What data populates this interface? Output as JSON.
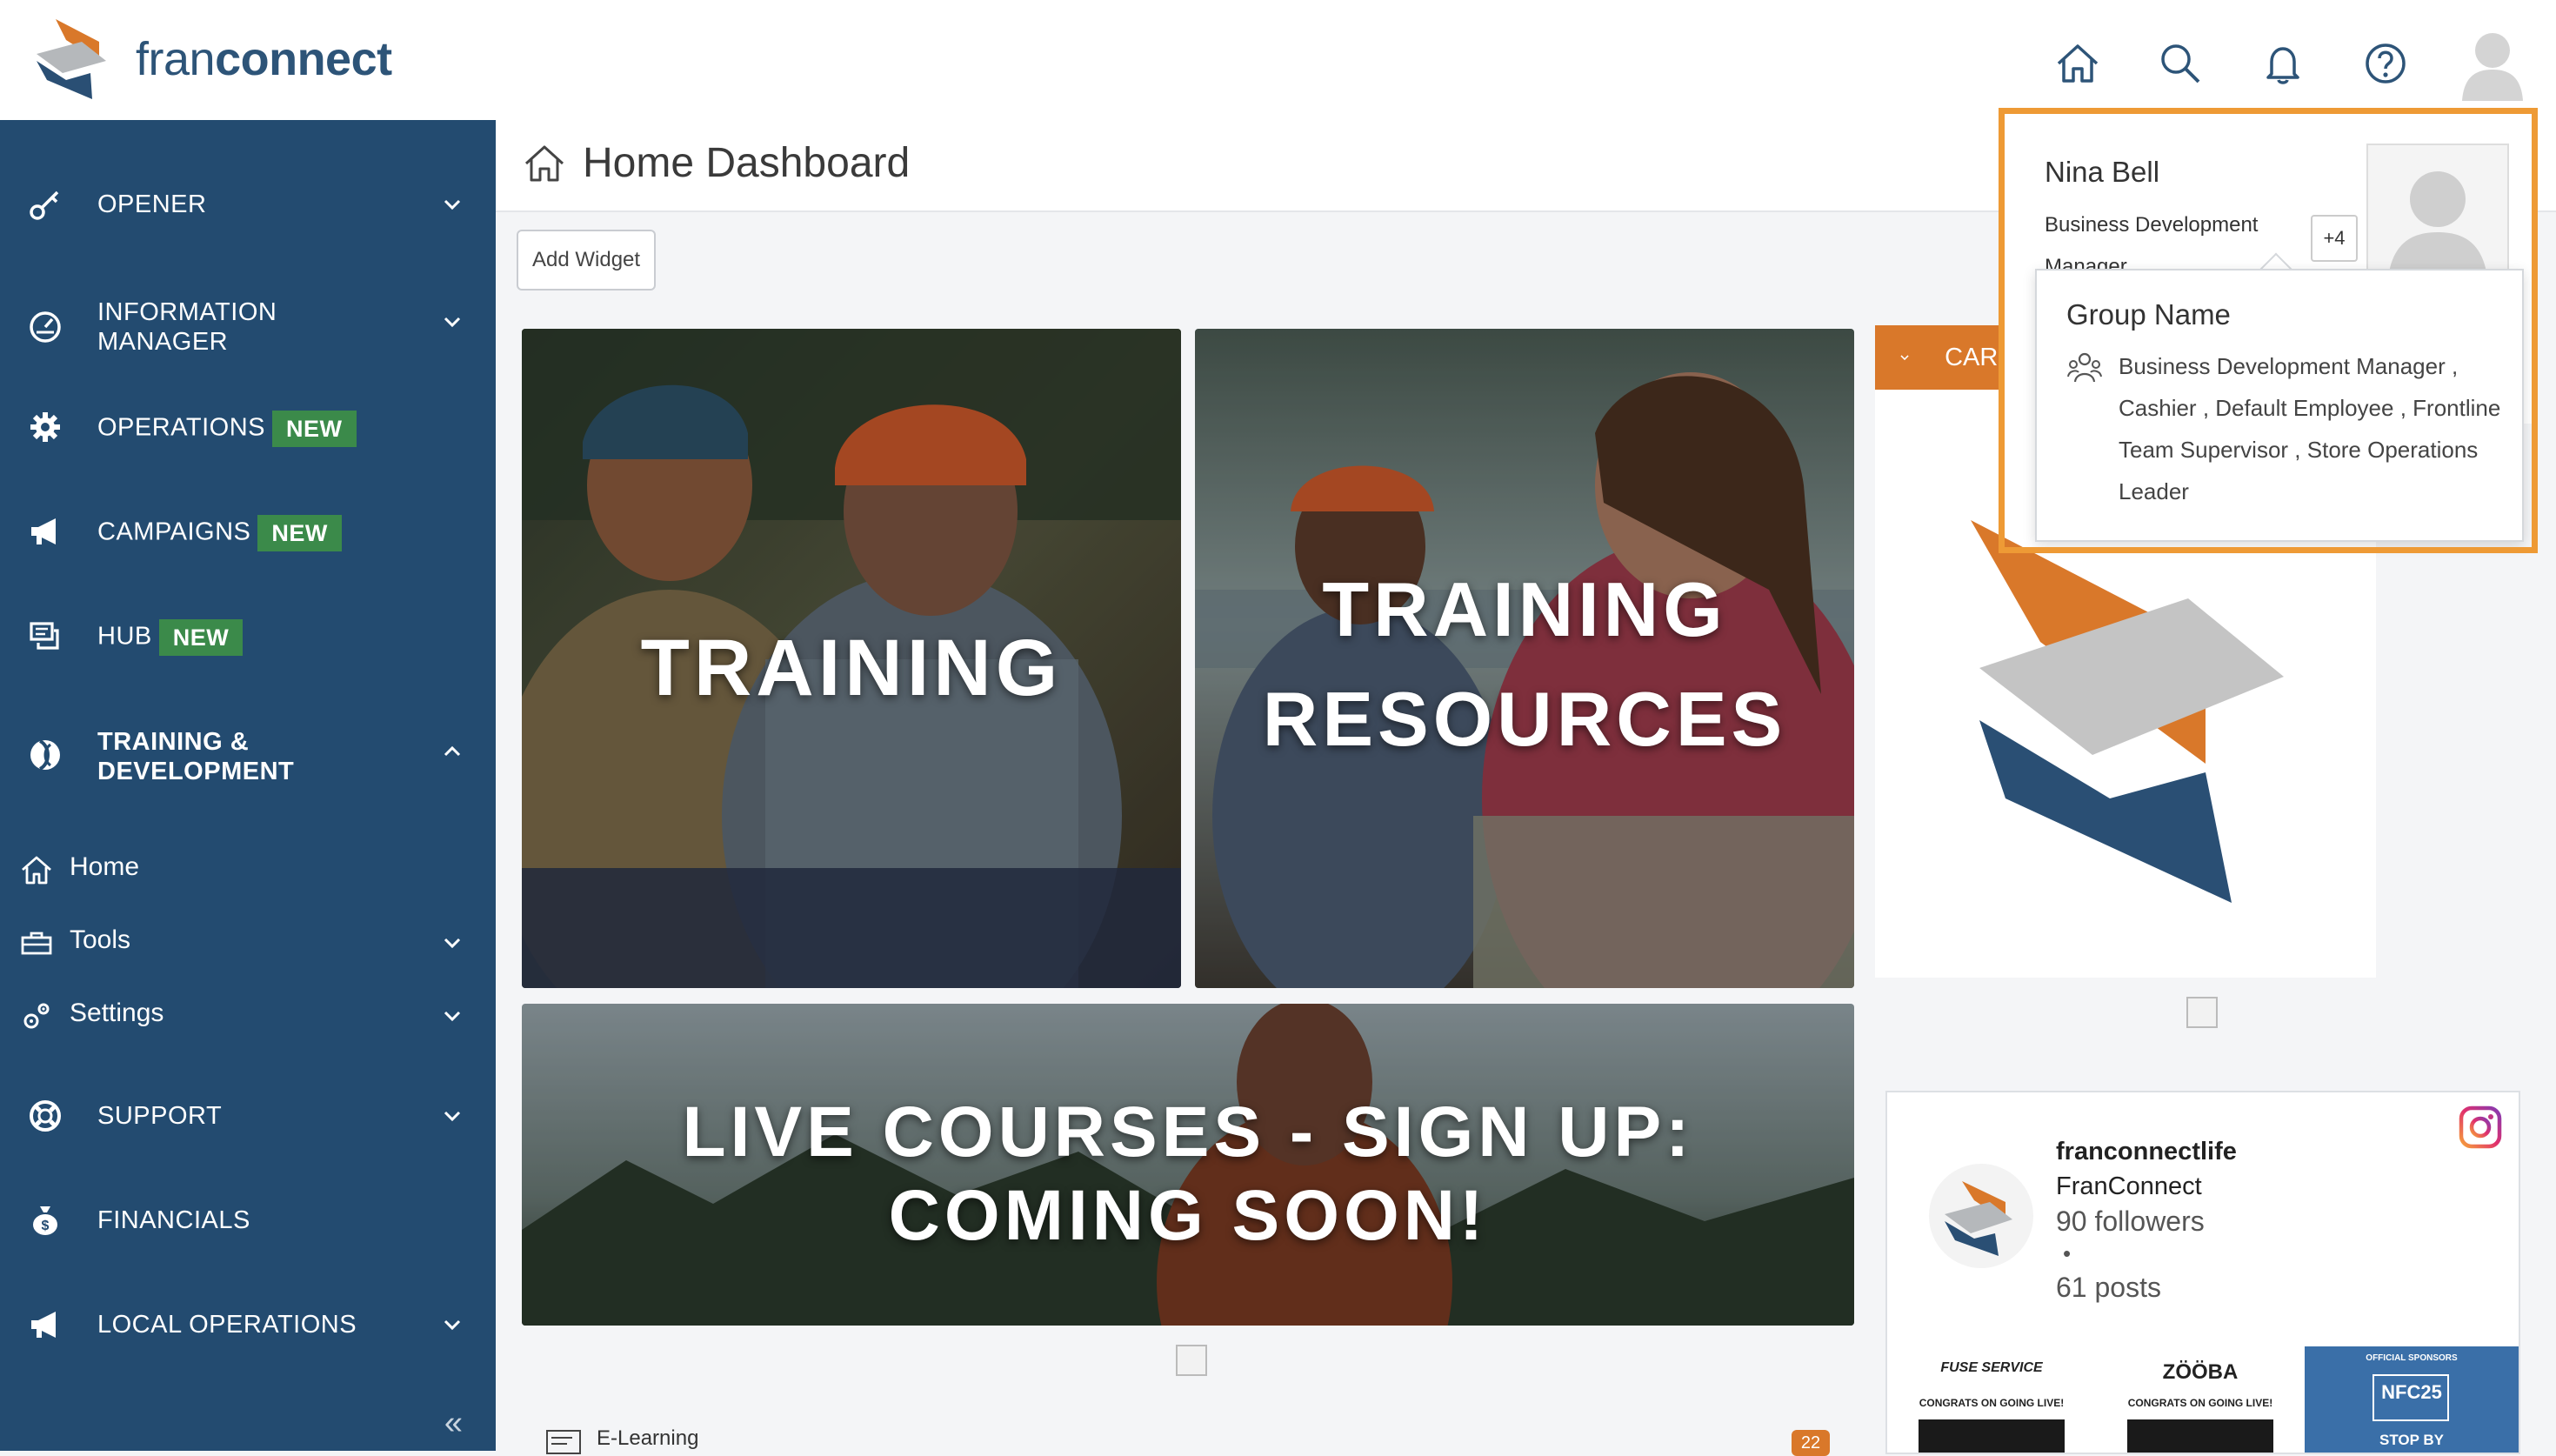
{
  "brand": {
    "name_part1": "fran",
    "name_part2": "connect",
    "accent": "#d9782a",
    "navy": "#234b70"
  },
  "header": {
    "icons": [
      "home-icon",
      "search-icon",
      "bell-icon",
      "help-icon",
      "user-avatar"
    ]
  },
  "sidebar": {
    "items": [
      {
        "label": "OPENER",
        "icon": "key-icon",
        "chevron": "down"
      },
      {
        "label": "INFORMATION",
        "label2": "MANAGER",
        "icon": "gauge-icon",
        "chevron": "down"
      },
      {
        "label": "OPERATIONS",
        "badge": "NEW",
        "icon": "gear-icon"
      },
      {
        "label": "CAMPAIGNS",
        "badge": "NEW",
        "icon": "megaphone-icon"
      },
      {
        "label": "HUB",
        "badge": "NEW",
        "icon": "chat-icon"
      },
      {
        "label": "TRAINING &",
        "label2": "DEVELOPMENT",
        "icon": "training-icon",
        "chevron": "up"
      },
      {
        "label": "SUPPORT",
        "icon": "lifebuoy-icon",
        "chevron": "down"
      },
      {
        "label": "FINANCIALS",
        "icon": "money-bag-icon"
      },
      {
        "label": "LOCAL OPERATIONS",
        "icon": "megaphone-icon",
        "chevron": "down"
      }
    ],
    "subitems": [
      {
        "label": "Home",
        "icon": "home-icon"
      },
      {
        "label": "Tools",
        "icon": "tools-icon",
        "chevron": "down"
      },
      {
        "label": "Settings",
        "icon": "settings-icon",
        "chevron": "down"
      }
    ],
    "collapse": "«"
  },
  "main": {
    "title": "Home Dashboard",
    "add_widget": "Add Widget",
    "tiles": {
      "training": "TRAINING",
      "resources_line1": "TRAINING",
      "resources_line2": "RESOURCES",
      "live_line1": "LIVE COURSES - SIGN UP:",
      "live_line2": "COMING SOON!"
    },
    "career_button": "CAREE",
    "elearning": "E-Learning",
    "elearning_count": "22"
  },
  "instagram": {
    "handle": "franconnectlife",
    "name": "FranConnect",
    "followers": "90 followers",
    "dot": "•",
    "posts": "61 posts",
    "thumbs": [
      {
        "title": "FUSE SERVICE",
        "caption": "CONGRATS ON GOING LIVE!"
      },
      {
        "title": "ZÖÖBA",
        "caption": "CONGRATS ON GOING LIVE!"
      },
      {
        "title": "NFC25",
        "top": "OFFICIAL SPONSORS",
        "caption": "STOP BY"
      }
    ]
  },
  "profile": {
    "name": "Nina Bell",
    "role": "Business Development Manager",
    "more_roles": "+4",
    "group_title": "Group Name",
    "group_roles": "Business Development Manager , Cashier , Default Employee , Frontline Team Supervisor , Store Operations Leader"
  }
}
